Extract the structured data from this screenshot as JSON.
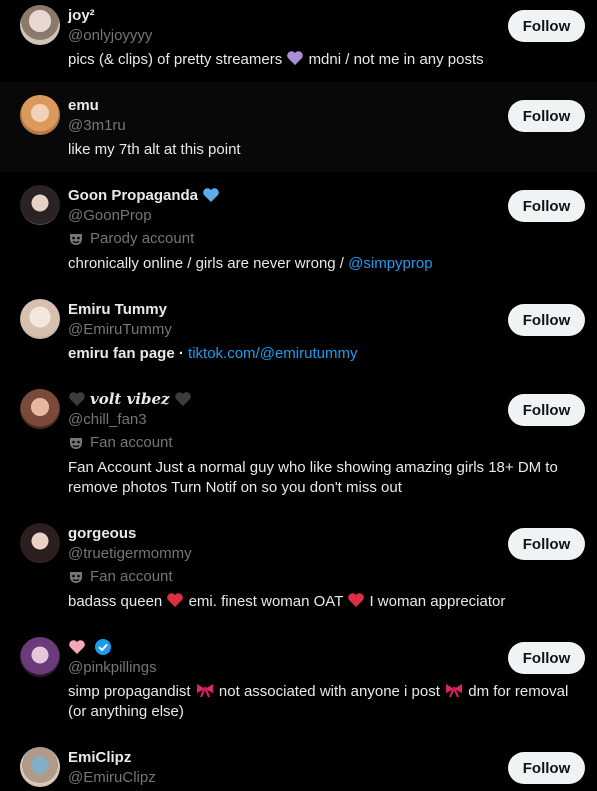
{
  "follow_label": "Follow",
  "accounts": [
    {
      "name": "joy²",
      "handle": "@onlyjoyyyy",
      "bio_a": "pics (& clips) of pretty streamers",
      "bio_b": "mdni / not me in any posts"
    },
    {
      "name": "emu",
      "handle": "@3m1ru",
      "bio": "like my 7th alt at this point"
    },
    {
      "name": "Goon Propaganda",
      "handle": "@GoonProp",
      "label": "Parody account",
      "bio": "chronically online / girls are never wrong / ",
      "bio_link": "@simpyprop"
    },
    {
      "name": "Emiru Tummy",
      "handle": "@EmiruTummy",
      "bio": "emiru fan page · ",
      "bio_link": "tiktok.com/@emirutummy"
    },
    {
      "name": "volt vibez",
      "handle": "@chill_fan3",
      "label": "Fan account",
      "bio": "Fan Account Just a normal guy who like showing amazing girls 18+ DM to remove photos Turn Notif on so you don't miss out"
    },
    {
      "name": "gorgeous",
      "handle": "@truetigermommy",
      "label": "Fan account",
      "bio_a": "badass queen",
      "bio_b": "emi. finest woman OAT",
      "bio_c": "I woman appreciator"
    },
    {
      "name": "",
      "handle": "@pinkpillings",
      "bio_a": "simp propagandist",
      "bio_b": "not associated with anyone i post",
      "bio_c": "dm for removal (or anything else)"
    },
    {
      "name": "EmiClipz",
      "handle": "@EmiruClipz"
    }
  ],
  "colors": {
    "link": "#1d9bf0",
    "muted": "#71767b",
    "text": "#e7e9ea",
    "follow_bg": "#eff3f4"
  }
}
